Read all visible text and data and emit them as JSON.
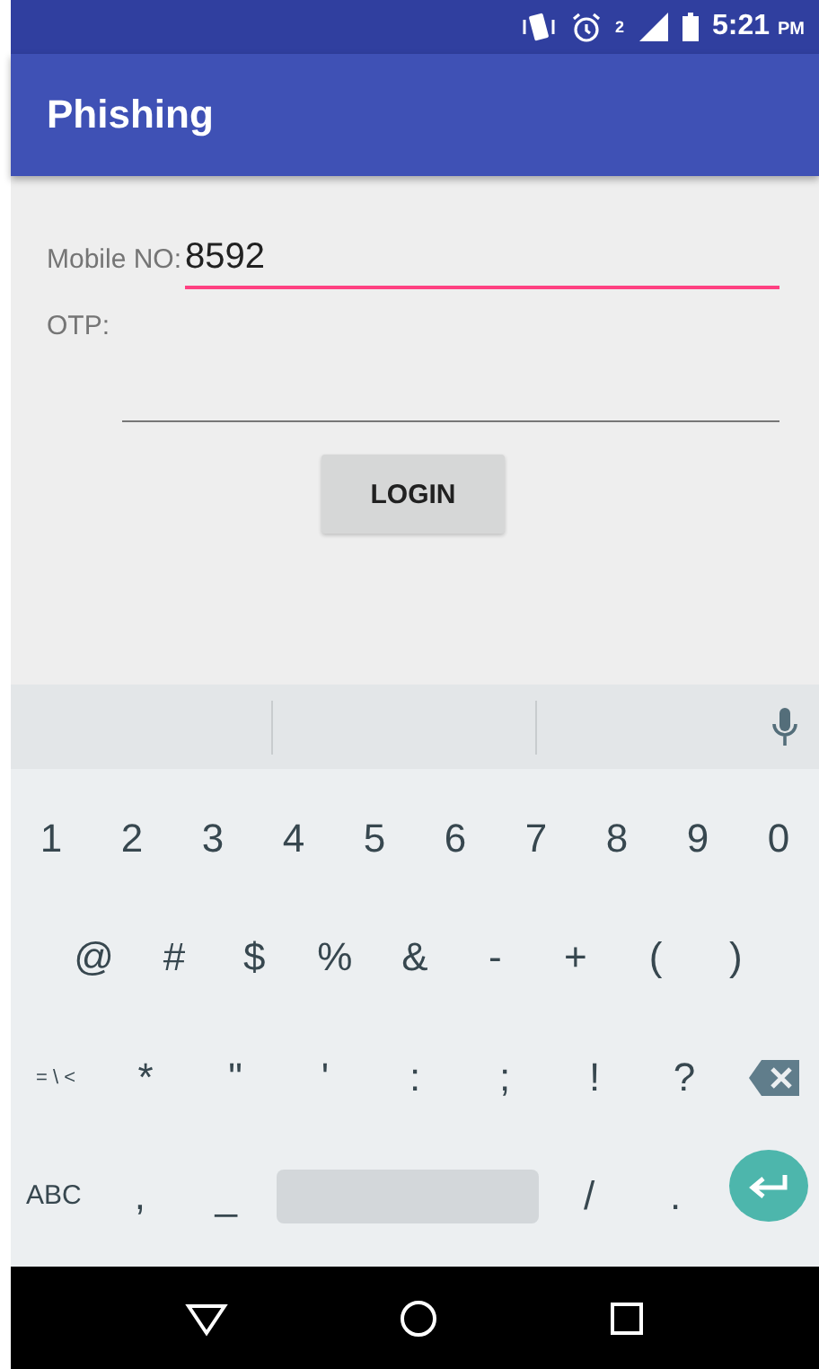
{
  "status_bar": {
    "signal_sim": "2",
    "time": "5:21",
    "meridiem": "PM"
  },
  "app_bar": {
    "title": "Phishing"
  },
  "form": {
    "fields": [
      {
        "label": "Mobile NO:",
        "value": "8592",
        "focused": true,
        "kind": "inline"
      },
      {
        "label": "OTP:",
        "focused": false,
        "kind": "stacked"
      }
    ],
    "button": "LOGIN"
  },
  "keyboard": {
    "rows": [
      [
        {
          "kind": "key",
          "label": "1"
        },
        {
          "kind": "key",
          "label": "2"
        },
        {
          "kind": "key",
          "label": "3"
        },
        {
          "kind": "key",
          "label": "4"
        },
        {
          "kind": "key",
          "label": "5"
        },
        {
          "kind": "key",
          "label": "6"
        },
        {
          "kind": "key",
          "label": "7"
        },
        {
          "kind": "key",
          "label": "8"
        },
        {
          "kind": "key",
          "label": "9"
        },
        {
          "kind": "key",
          "label": "0"
        }
      ],
      [
        {
          "kind": "key",
          "label": "@"
        },
        {
          "kind": "key",
          "label": "#"
        },
        {
          "kind": "key",
          "label": "$"
        },
        {
          "kind": "key",
          "label": "%"
        },
        {
          "kind": "key",
          "label": "&"
        },
        {
          "kind": "key",
          "label": "-"
        },
        {
          "kind": "key",
          "label": "+"
        },
        {
          "kind": "key",
          "label": "("
        },
        {
          "kind": "key",
          "label": ")"
        }
      ],
      [
        {
          "kind": "small",
          "label": "= \\ <"
        },
        {
          "kind": "key",
          "label": "*"
        },
        {
          "kind": "key",
          "label": "\""
        },
        {
          "kind": "key",
          "label": "'"
        },
        {
          "kind": "key",
          "label": ":"
        },
        {
          "kind": "key",
          "label": ";"
        },
        {
          "kind": "key",
          "label": "!"
        },
        {
          "kind": "key",
          "label": "?"
        },
        {
          "kind": "backspace"
        }
      ],
      [
        {
          "kind": "small",
          "label": "ABC"
        },
        {
          "kind": "key",
          "label": ","
        },
        {
          "kind": "key",
          "label": "_"
        },
        {
          "kind": "space"
        },
        {
          "kind": "key",
          "label": "/"
        },
        {
          "kind": "key",
          "label": "."
        },
        {
          "kind": "enter"
        }
      ]
    ]
  }
}
